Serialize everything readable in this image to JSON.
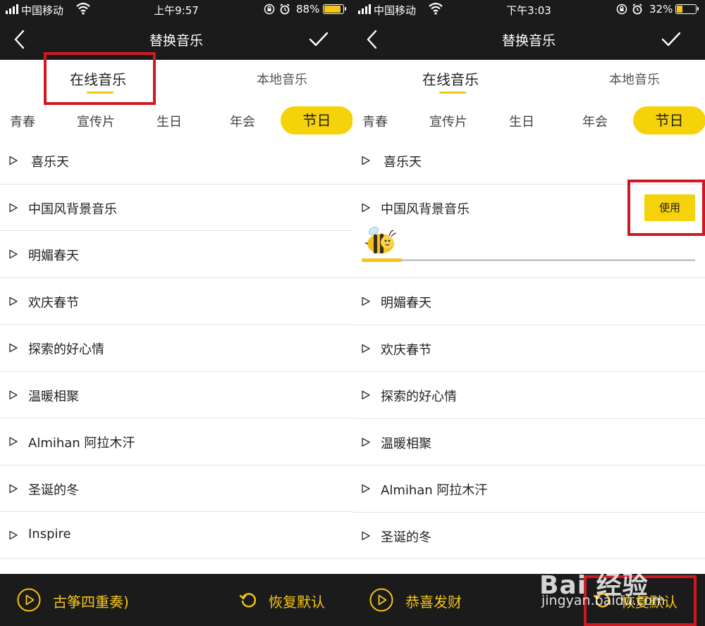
{
  "left": {
    "status": {
      "carrier": "中国移动",
      "time": "上午9:57",
      "battery": "88%",
      "battery_level": 0.88
    },
    "nav": {
      "title": "替换音乐"
    },
    "tabs": {
      "online": "在线音乐",
      "local": "本地音乐"
    },
    "categories": [
      "青春",
      "宣传片",
      "生日",
      "年会",
      "节日"
    ],
    "active_category": "节日",
    "songs": [
      "喜乐天",
      "中国风背景音乐",
      "明媚春天",
      "欢庆春节",
      "探索的好心情",
      "温暖相聚",
      "Almihan 阿拉木汗",
      "圣诞的冬",
      "Inspire"
    ],
    "bottom": {
      "current_song": "古筝四重奏)",
      "restore": "恢复默认"
    }
  },
  "right": {
    "status": {
      "carrier": "中国移动",
      "time": "下午3:03",
      "battery": "32%",
      "battery_level": 0.32
    },
    "nav": {
      "title": "替换音乐"
    },
    "tabs": {
      "online": "在线音乐",
      "local": "本地音乐"
    },
    "categories": [
      "青春",
      "宣传片",
      "生日",
      "年会",
      "节日"
    ],
    "active_category": "节日",
    "songs": [
      "喜乐天",
      "中国风背景音乐",
      "明媚春天",
      "欢庆春节",
      "探索的好心情",
      "温暖相聚",
      "Almihan 阿拉木汗",
      "圣诞的冬"
    ],
    "use_button": "使用",
    "playback_progress": 0.12,
    "bottom": {
      "current_song": "恭喜发财",
      "restore": "恢复默认"
    }
  },
  "watermark": {
    "logo": "Bai 经验",
    "url": "jingyan.baidu.com"
  },
  "colors": {
    "accent": "#f5d20a",
    "bar": "#1b1b1b",
    "highlight": "#d01822"
  },
  "icons": [
    "back-chevron-icon",
    "checkmark-icon",
    "play-triangle-icon",
    "play-circle-icon",
    "restore-icon",
    "wifi-icon",
    "alarm-icon",
    "orientation-lock-icon",
    "battery-icon",
    "bee-icon"
  ]
}
